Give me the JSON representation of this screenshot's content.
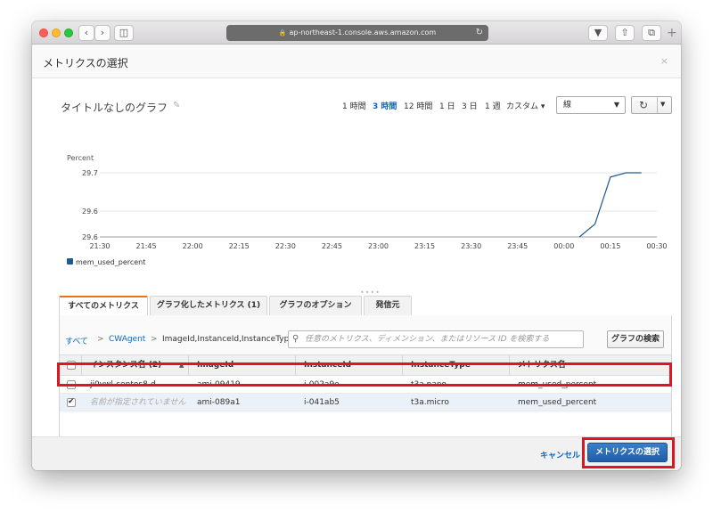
{
  "browser": {
    "url": "ap-northeast-1.console.aws.amazon.com",
    "back_icon": "chevron-left",
    "forward_icon": "chevron-right",
    "sidebar_icon": "sidebar",
    "download_icon": "download",
    "share_icon": "share",
    "tabs_icon": "tabs",
    "new_tab_icon": "plus"
  },
  "modal": {
    "title": "メトリクスの選択",
    "close": "×"
  },
  "graph": {
    "title": "タイトルなしのグラフ",
    "time_ranges": [
      "1 時間",
      "3 時間",
      "12 時間",
      "1 日",
      "3 日",
      "1 週",
      "カスタム ▾"
    ],
    "active_range_index": 1,
    "chart_type_value": "線",
    "refresh_icon": "↻"
  },
  "chart_data": {
    "type": "line",
    "ylabel": "Percent",
    "x_ticks": [
      "21:30",
      "21:45",
      "22:00",
      "22:15",
      "22:30",
      "22:45",
      "23:00",
      "23:15",
      "23:30",
      "23:45",
      "00:00",
      "00:15",
      "00:30"
    ],
    "y_ticks": [
      "29.7",
      "29.6",
      "29.6"
    ],
    "series": [
      {
        "name": "mem_used_percent",
        "color": "#1f5a96",
        "x": [
          "00:05",
          "00:10",
          "00:15",
          "00:20",
          "00:25"
        ],
        "y": [
          29.55,
          29.58,
          29.69,
          29.7,
          29.7
        ]
      }
    ],
    "legend": "bottom-left",
    "grid": true
  },
  "tabs": [
    "すべてのメトリクス",
    "グラフ化したメトリクス (1)",
    "グラフのオプション",
    "発信元"
  ],
  "active_tab_index": 0,
  "breadcrumb": {
    "all": "すべて",
    "separator": ">",
    "namespace": "CWAgent",
    "dimension": "ImageId,InstanceId,InstanceType"
  },
  "search": {
    "placeholder": "任意のメトリクス、ディメンション、またはリソース ID を検索する",
    "value": ""
  },
  "graph_search_button": "グラフの検索",
  "table": {
    "columns": [
      "インスタンス名 (2)",
      "ImageId",
      "InstanceId",
      "InstanceType",
      "メトリクス名"
    ],
    "rows": [
      {
        "checked": false,
        "selected": false,
        "instance_name": "ji0vwl-centos8-d",
        "image_id": "ami-09419",
        "instance_id": "i-002a9e",
        "instance_type": "t3a.nano",
        "metric_name": "mem_used_percent"
      },
      {
        "checked": true,
        "selected": true,
        "instance_name": "名前が指定されていません",
        "image_id": "ami-089a1",
        "instance_id": "i-041ab5",
        "instance_type": "t3a.micro",
        "metric_name": "mem_used_percent"
      }
    ]
  },
  "footer": {
    "cancel": "キャンセル",
    "select": "メトリクスの選択"
  }
}
